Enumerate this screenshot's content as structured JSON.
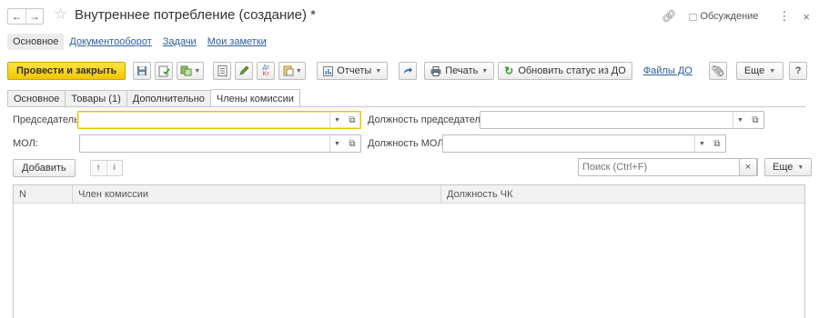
{
  "window": {
    "title": "Внутреннее потребление (создание) *",
    "discussion_label": "Обсуждение"
  },
  "section_tabs": [
    {
      "label": "Основное"
    },
    {
      "label": "Документооборот"
    },
    {
      "label": "Задачи"
    },
    {
      "label": "Мои заметки"
    }
  ],
  "toolbar": {
    "post_and_close": "Провести и закрыть",
    "reports": "Отчеты",
    "print": "Печать",
    "update_status": "Обновить статус из ДО",
    "files_do": "Файлы ДО",
    "more": "Еще",
    "help": "?",
    "dt_kt_top": "Дт",
    "dt_kt_bottom": "Кт"
  },
  "page_tabs": [
    {
      "label": "Основное"
    },
    {
      "label": "Товары (1)"
    },
    {
      "label": "Дополнительно"
    },
    {
      "label": "Члены комиссии"
    }
  ],
  "form": {
    "chairman_label": "Председатель:",
    "chairman_value": "",
    "chairman_position_label": "Должность председателя:",
    "chairman_position_value": "",
    "mol_label": "МОЛ:",
    "mol_value": "",
    "mol_position_label": "Должность МОЛ:",
    "mol_position_value": ""
  },
  "table_toolbar": {
    "add": "Добавить",
    "search_placeholder": "Поиск (Ctrl+F)",
    "clear": "×",
    "more": "Еще"
  },
  "table": {
    "columns": [
      "N",
      "Член комиссии",
      "Должность ЧК"
    ],
    "rows": []
  },
  "colors": {
    "primary_button": "#f5cd0a",
    "link": "#2c5d9c",
    "focus_border": "#f0c000"
  }
}
